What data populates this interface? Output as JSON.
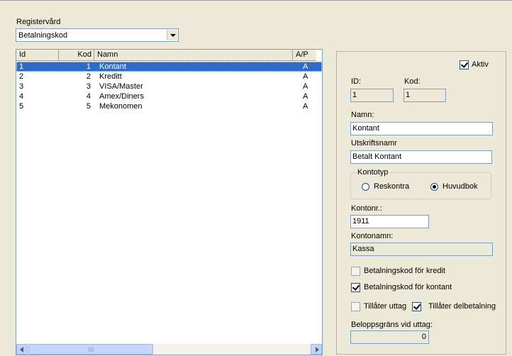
{
  "registervard": {
    "label": "Registervård",
    "selected": "Betalningskod"
  },
  "table": {
    "headers": {
      "id": "Id",
      "kod": "Kod",
      "namn": "Namn",
      "ap": "A/P"
    },
    "rows": [
      {
        "id": "1",
        "kod": "1",
        "namn": "Kontant",
        "ap": "A"
      },
      {
        "id": "2",
        "kod": "2",
        "namn": "Kreditt",
        "ap": "A"
      },
      {
        "id": "3",
        "kod": "3",
        "namn": "VISA/Master",
        "ap": "A"
      },
      {
        "id": "4",
        "kod": "4",
        "namn": "Amex/Diners",
        "ap": "A"
      },
      {
        "id": "5",
        "kod": "5",
        "namn": "Mekonomen",
        "ap": "A"
      }
    ],
    "selected_row": 0
  },
  "detail": {
    "aktiv_label": "Aktiv",
    "aktiv_checked": true,
    "id_label": "ID:",
    "id_value": "1",
    "kod_label": "Kod:",
    "kod_value": "1",
    "namn_label": "Namn:",
    "namn_value": "Kontant",
    "utskriftsnamn_label": "Utskriftsnamr",
    "utskriftsnamn_value": "Betalt Kontant",
    "kontotyp_label": "Kontotyp",
    "reskontra_label": "Reskontra",
    "huvudbok_label": "Huvudbok",
    "kontotyp_selected": "huvudbok",
    "kontonr_label": "Kontonr.:",
    "kontonr_value": "1911",
    "kontonamn_label": "Kontonamn:",
    "kontonamn_value": "Kassa",
    "kredit_label": "Betalningskod för kredit",
    "kredit_checked": false,
    "kontant_label": "Betalningskod för kontant",
    "kontant_checked": true,
    "uttag_label": "Tillåter uttag",
    "uttag_checked": false,
    "delbetalning_label": "Tillåter delbetalning",
    "delbetalning_checked": true,
    "belopp_label": "Beloppsgräns vid uttag:",
    "belopp_value": "0"
  },
  "colors": {
    "selection": "#316ac5",
    "window": "#ece9d8",
    "border": "#7f9db9"
  }
}
